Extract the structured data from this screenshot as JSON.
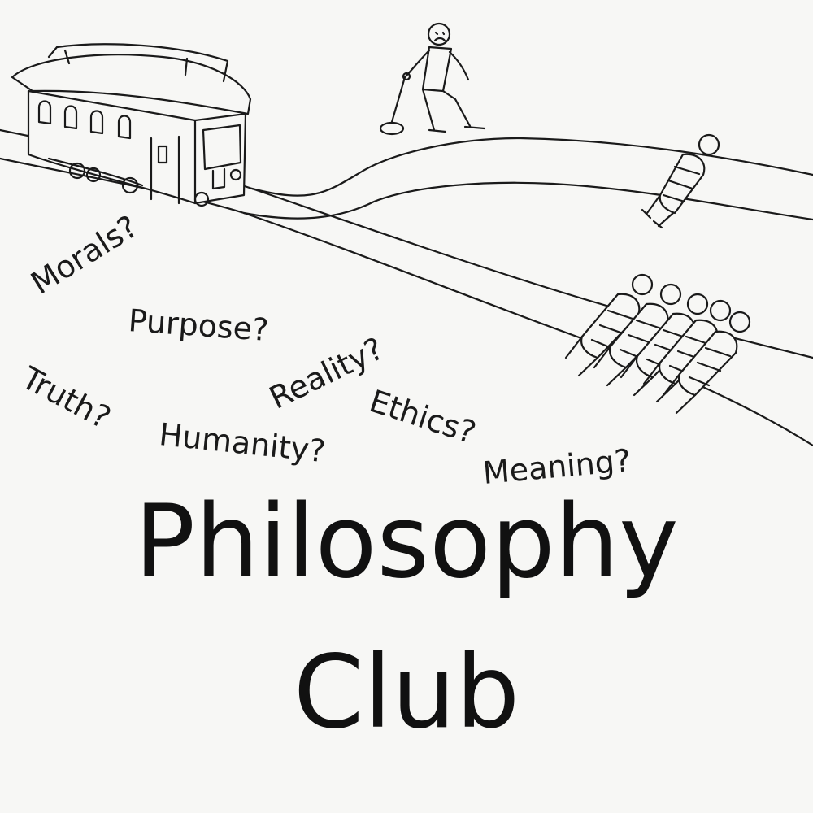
{
  "words": {
    "morals": "Morals?",
    "purpose": "Purpose?",
    "truth": "Truth?",
    "reality": "Reality?",
    "ethics": "Ethics?",
    "humanity": "Humanity?",
    "meaning": "Meaning?"
  },
  "title": {
    "line1": "Philosophy",
    "line2": "Club"
  },
  "colors": {
    "ink": "#111111",
    "paper": "#f7f7f5"
  }
}
